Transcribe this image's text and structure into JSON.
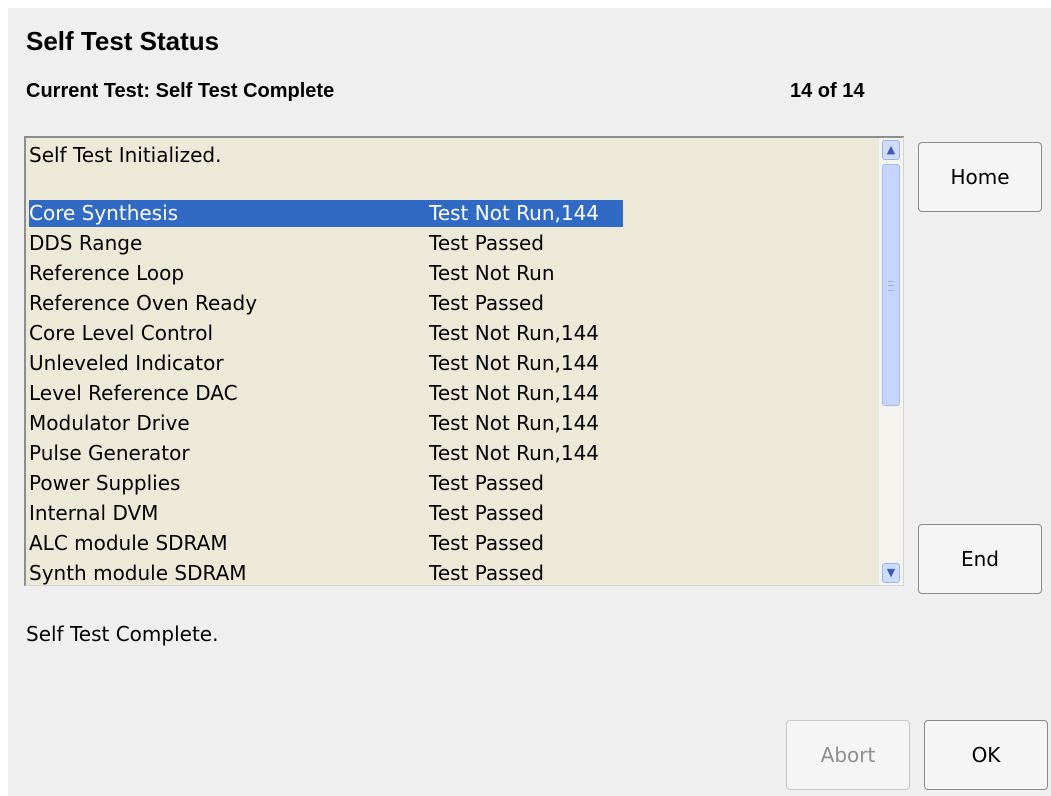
{
  "dialog": {
    "title": "Self Test Status",
    "current_test": "Current Test: Self Test Complete",
    "counter": "14 of 14"
  },
  "log": {
    "header_line": "Self Test Initialized.",
    "rows": [
      {
        "name": "Core Synthesis",
        "status": "Test Not Run,144",
        "selected": true
      },
      {
        "name": "DDS Range",
        "status": "Test Passed"
      },
      {
        "name": "Reference Loop",
        "status": "Test Not Run"
      },
      {
        "name": "Reference Oven Ready",
        "status": "Test Passed"
      },
      {
        "name": "Core Level Control",
        "status": "Test Not Run,144"
      },
      {
        "name": "Unleveled Indicator",
        "status": "Test Not Run,144"
      },
      {
        "name": "Level Reference DAC",
        "status": "Test Not Run,144"
      },
      {
        "name": "Modulator Drive",
        "status": "Test Not Run,144"
      },
      {
        "name": "Pulse Generator",
        "status": "Test Not Run,144"
      },
      {
        "name": "Power Supplies",
        "status": "Test Passed"
      },
      {
        "name": "Internal DVM",
        "status": "Test Passed"
      },
      {
        "name": "ALC module SDRAM",
        "status": "Test Passed"
      },
      {
        "name": "Synth module SDRAM",
        "status": "Test Passed"
      }
    ]
  },
  "status_message": "Self Test Complete.",
  "buttons": {
    "home": "Home",
    "end": "End",
    "abort": "Abort",
    "ok": "OK"
  },
  "icons": {
    "scroll_up": "chevron-up-icon",
    "scroll_down": "chevron-down-icon"
  },
  "colors": {
    "selection": "#316ac5",
    "list_background": "#ece9d8"
  }
}
